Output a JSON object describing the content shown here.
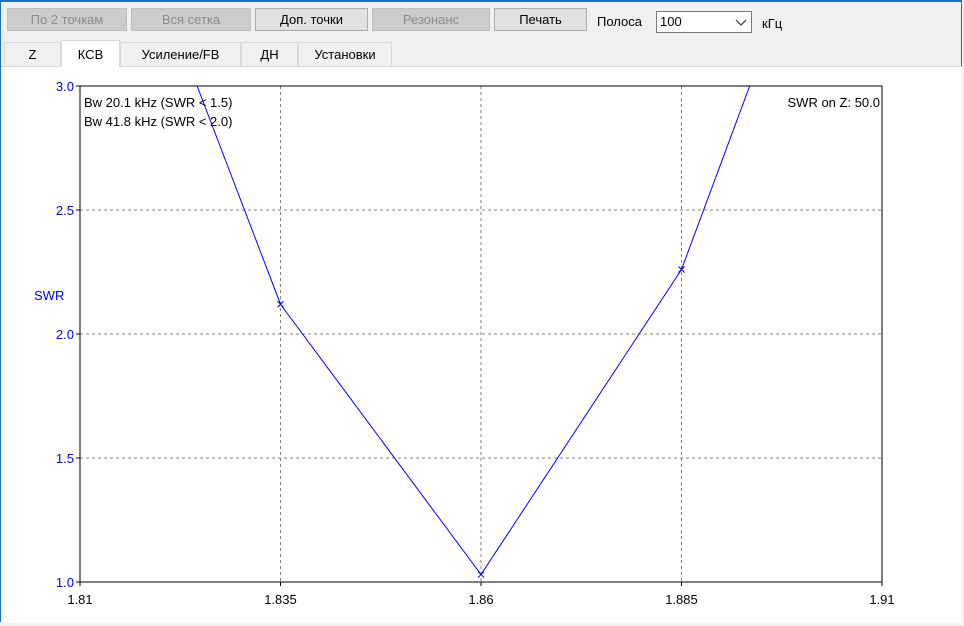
{
  "toolbar": {
    "by_two_points": "По 2 точкам",
    "whole_grid": "Вся сетка",
    "extra_points": "Доп. точки",
    "resonance": "Резонанс",
    "print": "Печать",
    "band_label": "Полоса",
    "band_value": "100",
    "band_unit": "кГц"
  },
  "tabs": [
    {
      "label": "Z"
    },
    {
      "label": "КСВ"
    },
    {
      "label": "Усиление/FB"
    },
    {
      "label": "ДН"
    },
    {
      "label": "Установки"
    }
  ],
  "active_tab": "КСВ",
  "colors": {
    "accent": "#0000ff",
    "axis_text": "#0000ff",
    "grid": "#808080"
  },
  "chart_data": {
    "type": "line",
    "ylabel": "SWR",
    "xlabel": "",
    "xlim": [
      1.81,
      1.91
    ],
    "ylim": [
      1.0,
      3.0
    ],
    "x_ticks": [
      "1.81",
      "1.835",
      "1.86",
      "1.885",
      "1.91"
    ],
    "y_ticks": [
      "1.0",
      "1.5",
      "2.0",
      "2.5",
      "3.0"
    ],
    "grid": true,
    "series": [
      {
        "x": [
          1.8246,
          1.835,
          1.86,
          1.885,
          1.8935
        ],
        "y": [
          3.0,
          2.12,
          1.03,
          2.26,
          3.0
        ],
        "markers_at": [
          1.835,
          1.86,
          1.885
        ]
      }
    ],
    "annotations": [
      "Bw 20.1 kHz (SWR < 1.5)",
      "Bw 41.8 kHz (SWR < 2.0)",
      "SWR on Z: 50.0"
    ]
  }
}
